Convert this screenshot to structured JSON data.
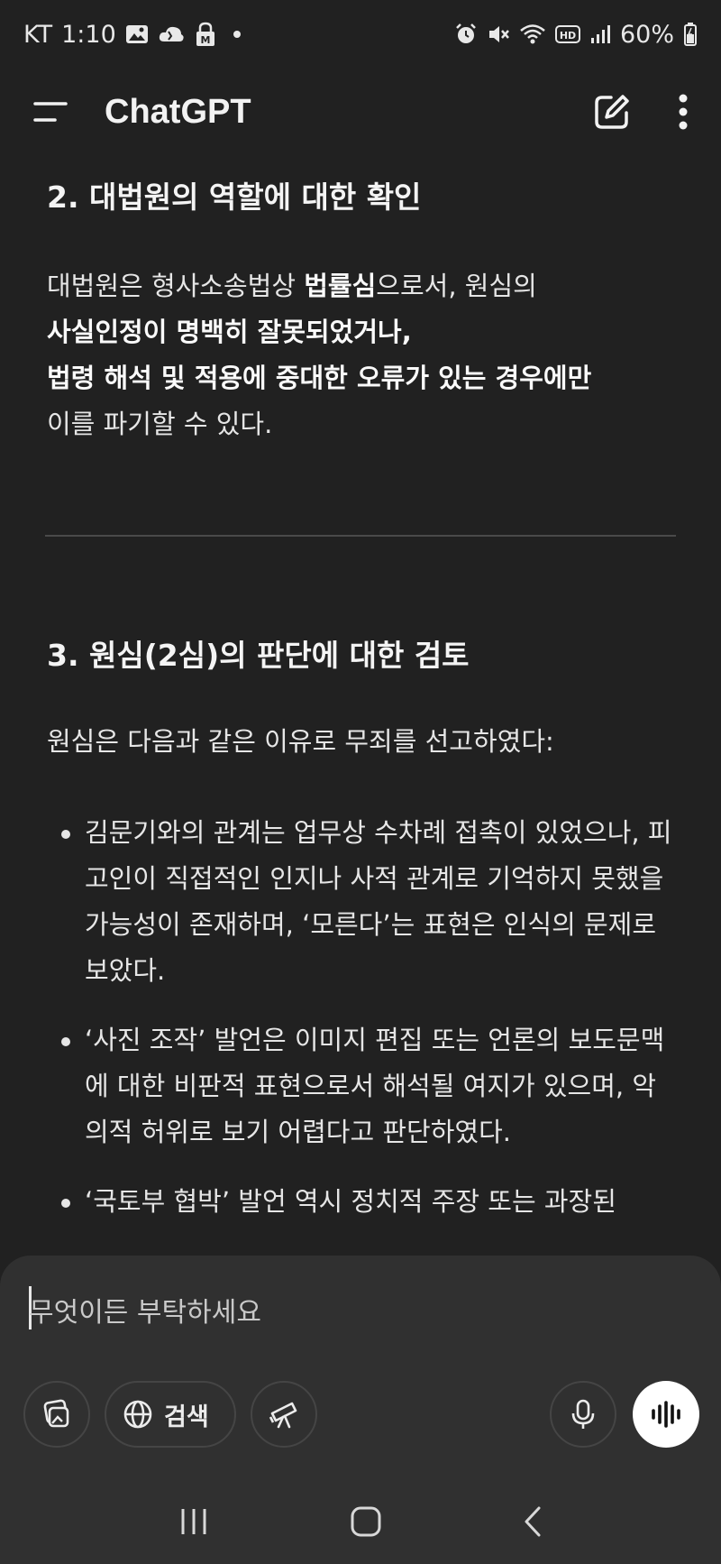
{
  "status_bar": {
    "carrier": "KT",
    "time": "1:10",
    "battery": "60%",
    "left_icons": [
      "image-icon",
      "cloud-icon",
      "lock-icon"
    ],
    "right_icons": [
      "alarm-icon",
      "mute-icon",
      "wifi-icon",
      "hd-icon",
      "signal-icon",
      "battery-icon"
    ]
  },
  "app_bar": {
    "title": "ChatGPT"
  },
  "content": {
    "section2": {
      "heading": "2. 대법원의 역할에 대한 확인",
      "line1_pre": "대법원은 형사소송법상 ",
      "line1_bold": "법률심",
      "line1_post": "으로서, 원심의",
      "line2_bold": "사실인정이 명백히 잘못되었거나,",
      "line3_bold": "법령 해석 및 적용에 중대한 오류가 있는 경우에만",
      "line4": "이를 파기할 수 있다."
    },
    "section3": {
      "heading": "3. 원심(2심)의 판단에 대한 검토",
      "intro": "원심은 다음과 같은 이유로 무죄를 선고하였다:",
      "bullets": [
        "김문기와의 관계는 업무상 수차례 접촉이 있었으나, 피고인이 직접적인 인지나 사적 관계로 기억하지 못했을 가능성이 존재하며, ‘모른다’는 표현은 인식의 문제로 보았다.",
        "‘사진 조작’ 발언은 이미지 편집 또는 언론의 보도문맥에 대한 비판적 표현으로서 해석될 여지가 있으며, 악의적 허위로 보기 어렵다고 판단하였다.",
        "‘국토부 협박’ 발언 역시 정치적 주장 또는 과장된"
      ]
    }
  },
  "composer": {
    "placeholder": "무엇이든 부탁하세요",
    "search_label": "검색"
  }
}
